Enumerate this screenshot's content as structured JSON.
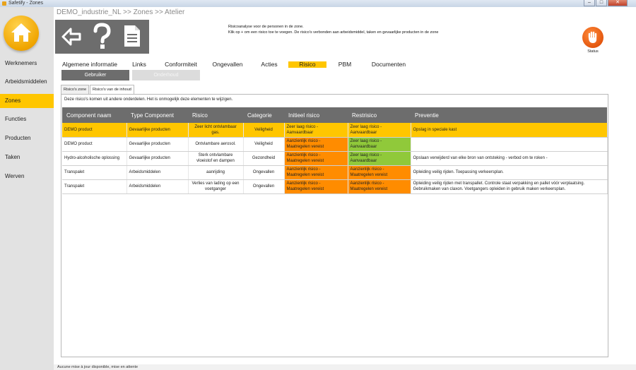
{
  "window": {
    "title": "Safetify - Zones"
  },
  "breadcrumb": "DEMO_industrie_NL >> Zones >> Atelier",
  "info": {
    "line1": "Risicoanalyse voor de personen in de zone.",
    "line2": "Klik op + om een risico toe te voegen. De risico's verbonden aan arbeidsmiddel, taken en gevaarlijke producten in de zone"
  },
  "status_label": "Status",
  "sidebar": {
    "items": [
      {
        "label": "Werknemers"
      },
      {
        "label": "Arbeidsmiddelen"
      },
      {
        "label": "Zones"
      },
      {
        "label": "Functies"
      },
      {
        "label": "Producten"
      },
      {
        "label": "Taken"
      },
      {
        "label": "Werven"
      }
    ],
    "active": "Zones"
  },
  "tabs": [
    {
      "label": "Algemene informatie"
    },
    {
      "label": "Links"
    },
    {
      "label": "Conformiteit"
    },
    {
      "label": "Ongevallen"
    },
    {
      "label": "Acties"
    },
    {
      "label": "Risico"
    },
    {
      "label": "PBM"
    },
    {
      "label": "Documenten"
    }
  ],
  "subbuttons": {
    "gebruiker": "Gebruiker",
    "onderhoud": "Onderhoud"
  },
  "inner_tabs": {
    "zone": "Risico's zone",
    "inhoud": "Risico's van de inhoud"
  },
  "panel_note": "Deze risico's komen uit andere onderdelen. Het is onmogelijk deze elementen te wijzigen.",
  "table": {
    "headers": [
      "Component naam",
      "Type Component",
      "Risico",
      "Categorie",
      "Initieel risico",
      "Restrisico",
      "Preventie"
    ],
    "rows": [
      {
        "component": "DEMO product",
        "type": "Gevaarlijke producten",
        "risico": "Zeer licht ontvlambaar gas.",
        "categorie": "Veiligheid",
        "initieel": "Zeer laag risico - Aanvaardbaar",
        "rest": "Zeer laag risico - Aanvaardbaar",
        "preventie": "Opslag in speciale kast"
      },
      {
        "component": "DEMO product",
        "type": "Gevaarlijke producten",
        "risico": "Ontvlambare aerosol.",
        "categorie": "Veiligheid",
        "initieel": "Aanzienlijk risico - Maatregelen vereist",
        "rest": "Zeer laag risico - Aanvaardbaar",
        "preventie": ""
      },
      {
        "component": "Hydro-alcoholische oplossing",
        "type": "Gevaarlijke producten",
        "risico": "Sterk ontvlambare vloeistof en dampen",
        "categorie": "Gezondheid",
        "initieel": "Aanzienlijk risico - Maatregelen vereist",
        "rest": "Zeer laag risico - Aanvaardbaar",
        "preventie": "Opslaan verwijderd van elke bron van ontsteking - verbod om te roken -"
      },
      {
        "component": "Transpalet",
        "type": "Arbeidsmiddelen",
        "risico": "aanrijding",
        "categorie": "Ongevallen",
        "initieel": "Aanzienlijk risico - Maatregelen vereist",
        "rest": "Aanzienlijk risico - Maatregelen vereist",
        "preventie": "Opleiding veilig rijden. Toepassing verkeersplan."
      },
      {
        "component": "Transpalet",
        "type": "Arbeidsmiddelen",
        "risico": "Verlies van lading op een voetganger",
        "categorie": "Ongevallen",
        "initieel": "Aanzienlijk risico - Maatregelen vereist",
        "rest": "Aanzienlijk risico - Maatregelen vereist",
        "preventie": "Opleiding veilig rijden met transpallet. Controle staat verpakking en pallet vóór verplaatsing. Gebruikmaken van claxon. Voetgangers opleiden in gebruik maken verkeersplan."
      }
    ]
  },
  "statusbar": "Aucune mise à jour disponible, mise en attente",
  "colors": {
    "accent": "#ffc600",
    "dark": "#6d6d6d",
    "high_risk": "#ff8c00",
    "low_risk": "#90c93a",
    "status_btn": "#e2540c"
  },
  "icons": [
    "home-icon",
    "back-arrow-icon",
    "help-icon",
    "document-icon",
    "stop-hand-icon"
  ]
}
